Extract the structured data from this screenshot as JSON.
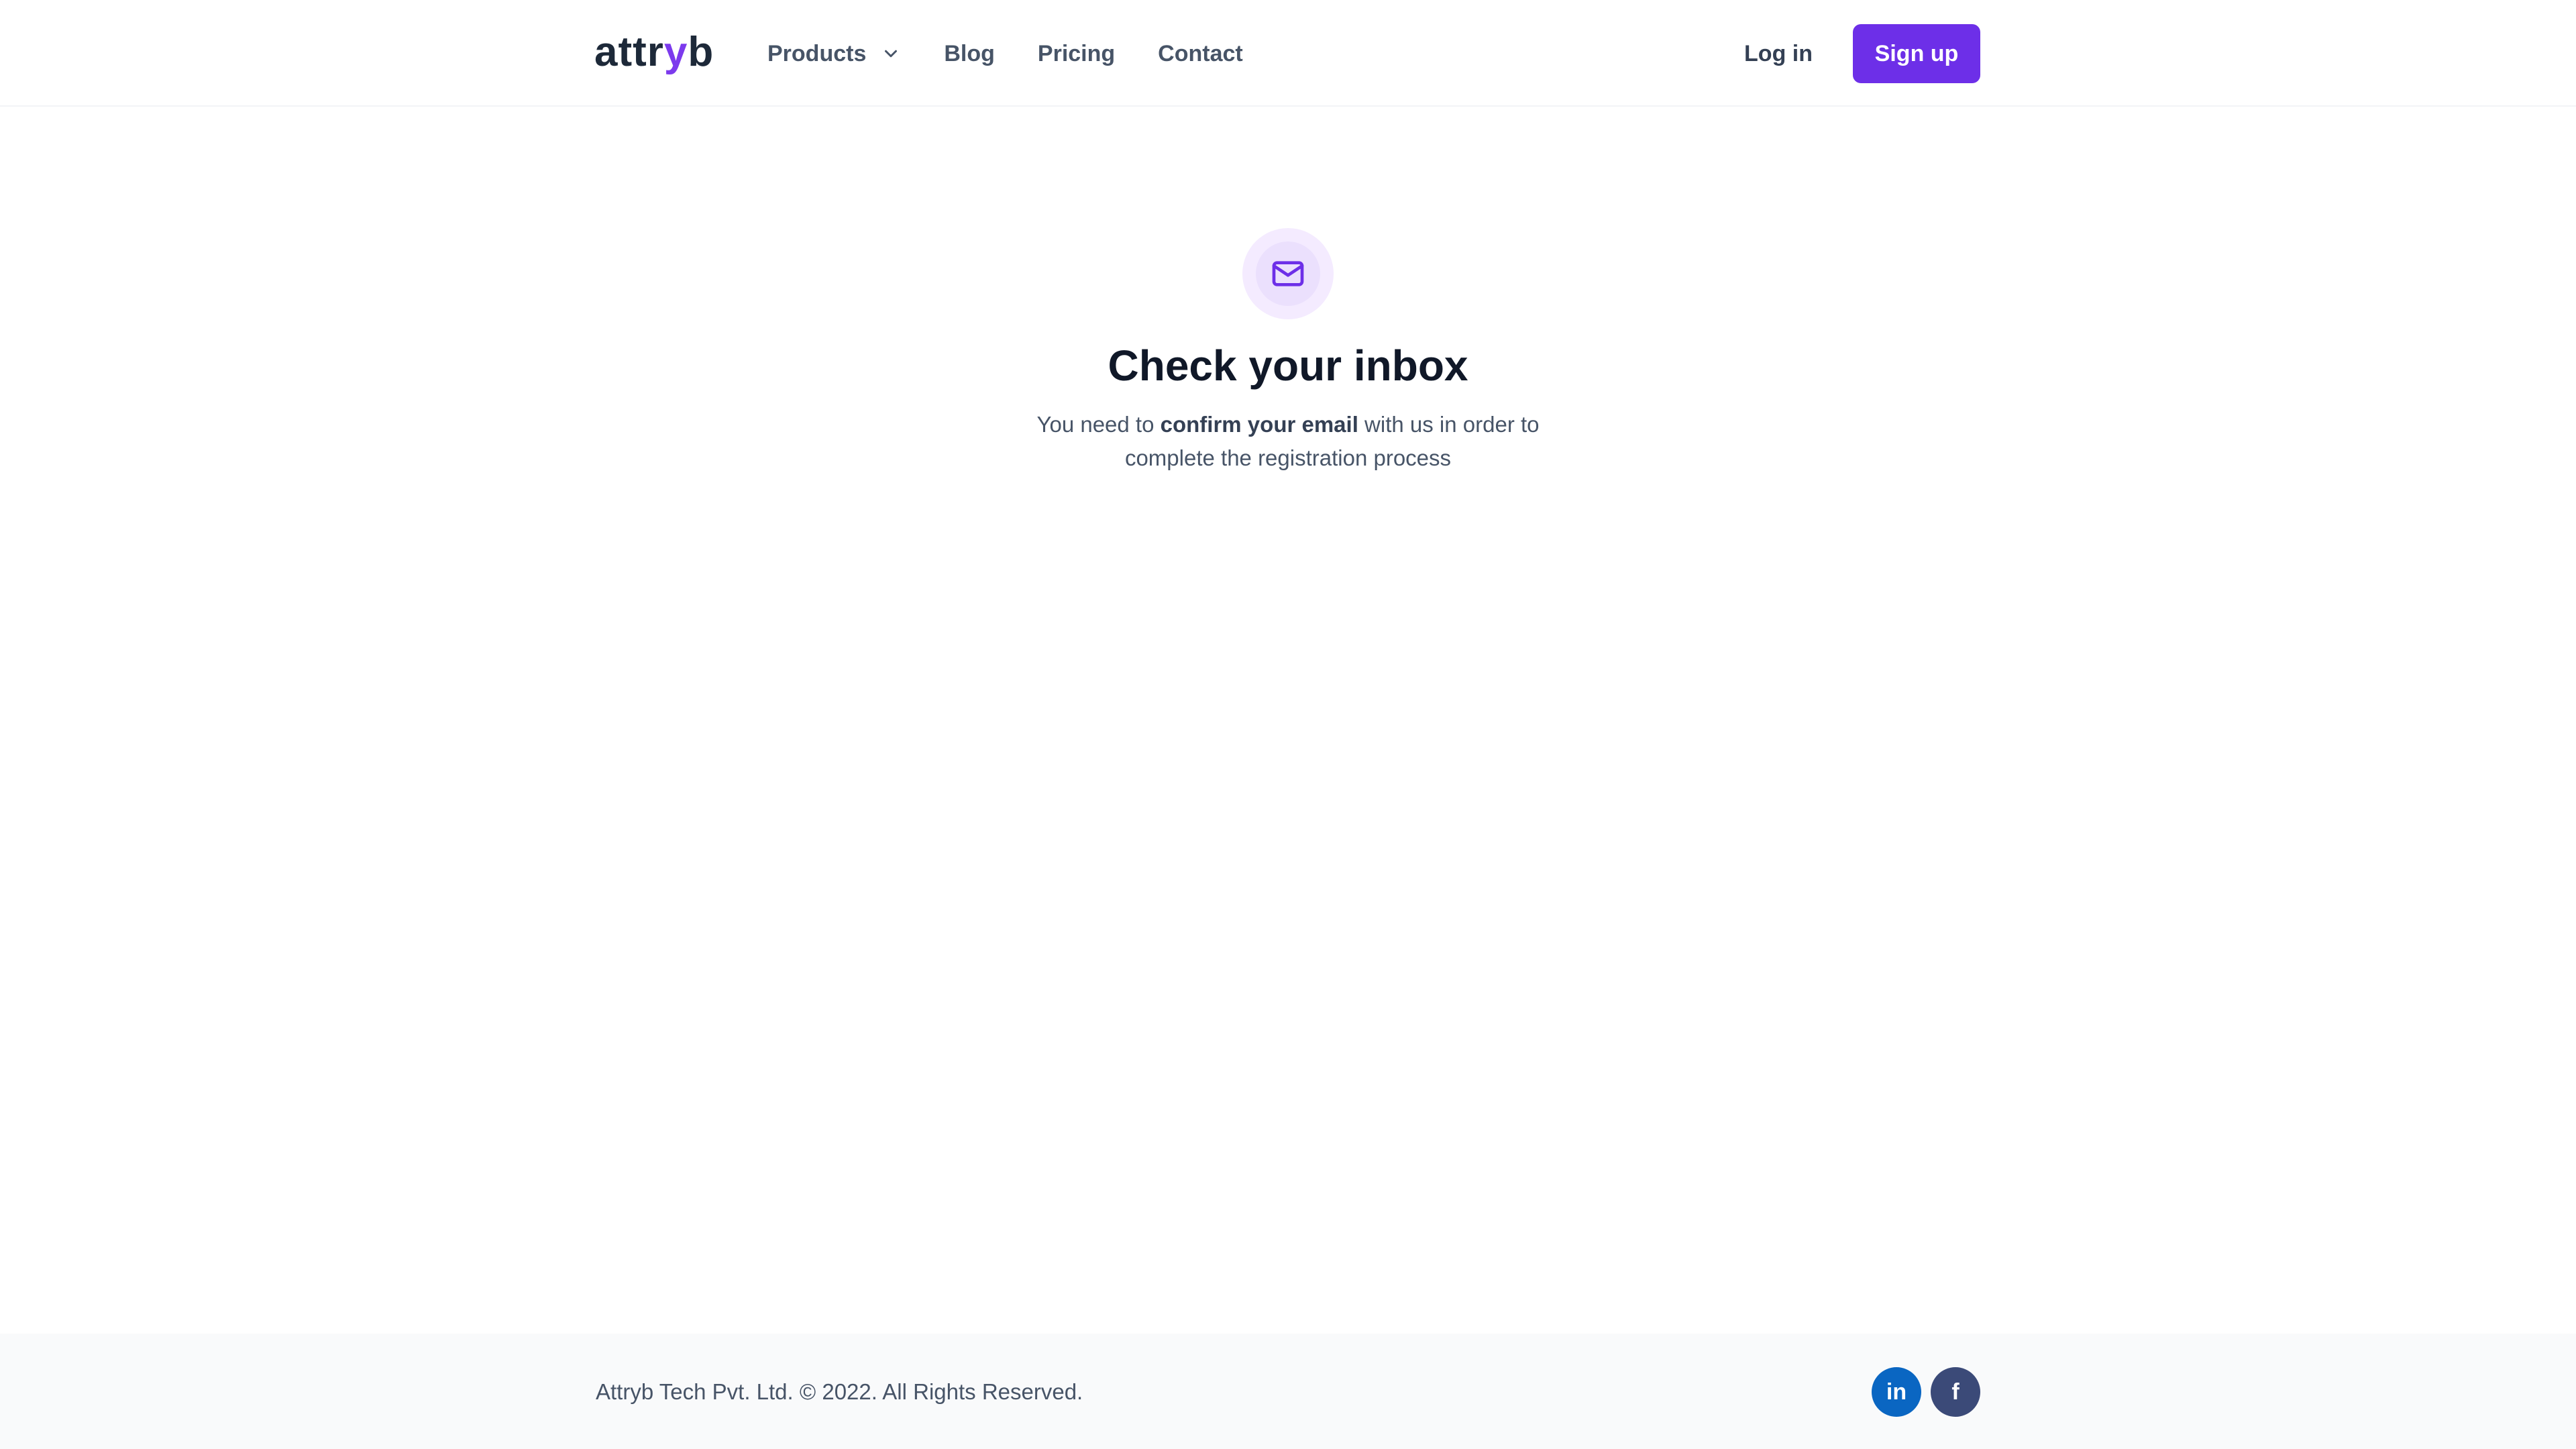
{
  "header": {
    "logo_prefix": "attr",
    "logo_accent": "y",
    "logo_suffix": "b",
    "nav": {
      "products": "Products",
      "blog": "Blog",
      "pricing": "Pricing",
      "contact": "Contact"
    },
    "login_label": "Log in",
    "signup_label": "Sign up"
  },
  "main": {
    "icon": "mail-icon",
    "title": "Check your inbox",
    "desc_pre": "You need to ",
    "desc_bold": "confirm your email",
    "desc_post": " with us in order to complete the registration process"
  },
  "footer": {
    "copyright": "Attryb Tech Pvt. Ltd. © 2022. All Rights Reserved.",
    "social": {
      "linkedin_icon": "linkedin-icon",
      "linkedin_glyph": "in",
      "facebook_icon": "facebook-icon",
      "facebook_glyph": "f"
    }
  },
  "colors": {
    "brand": "#6d2fe8",
    "logo_accent": "#7c3aed",
    "icon_bg": "#f4ebff",
    "linkedin": "#0a66c2",
    "facebook": "#3b4a78"
  }
}
